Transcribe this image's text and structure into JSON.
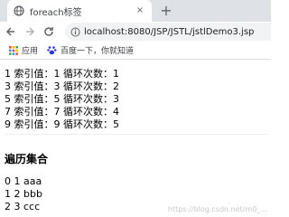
{
  "browser": {
    "tab_title": "foreach标签",
    "tab_close": "×",
    "new_tab": "+",
    "url": "localhost:8080/JSP/JSTL/jstlDemo3.jsp",
    "bookmarks": [
      {
        "label": "应用",
        "icon": "apps-grid-icon"
      },
      {
        "label": "百度一下，你就知道",
        "icon": "baidu-paw-icon"
      }
    ]
  },
  "page": {
    "loop_lines": [
      "1 索引值：1 循环次数：1",
      "3 索引值：3 循环次数：2",
      "5 索引值：5 循环次数：3",
      "7 索引值：7 循环次数：4",
      "9 索引值：9 循环次数：5"
    ],
    "heading": "遍历集合",
    "list_lines": [
      "0 1 aaa",
      "1 2 bbb",
      "2 3 ccc"
    ],
    "watermark": "https://blog.csdn.net/m0_..."
  }
}
